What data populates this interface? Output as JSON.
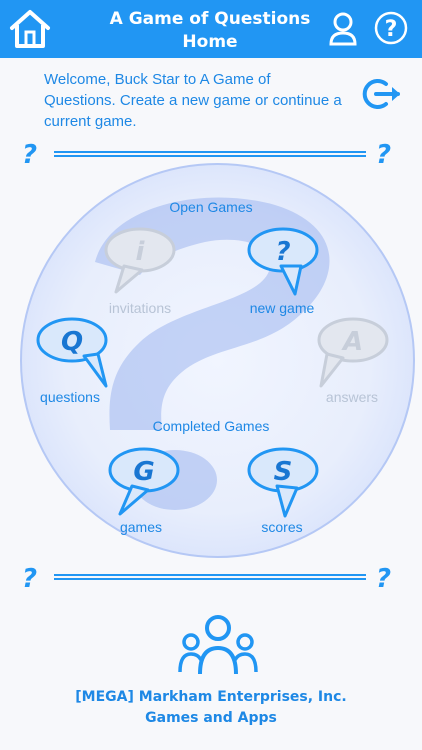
{
  "header": {
    "title_line1": "A Game of Questions",
    "title_line2": "Home",
    "home_icon": "home-icon",
    "profile_icon": "user-icon",
    "help_icon": "help-icon"
  },
  "welcome": {
    "text": "Welcome, Buck Star to A Game of Questions. Create a new game or continue a current game."
  },
  "logout_icon": "logout-icon",
  "divider_mark": "?",
  "open_games": {
    "heading": "Open Games",
    "items": [
      {
        "label": "invitations",
        "glyph": "i",
        "active": false
      },
      {
        "label": "new game",
        "glyph": "?",
        "active": true
      },
      {
        "label": "questions",
        "glyph": "Q",
        "active": true
      },
      {
        "label": "answers",
        "glyph": "A",
        "active": false
      }
    ]
  },
  "completed_games": {
    "heading": "Completed Games",
    "items": [
      {
        "label": "games",
        "glyph": "G",
        "active": true
      },
      {
        "label": "scores",
        "glyph": "S",
        "active": true
      }
    ]
  },
  "footer": {
    "line1": "[MEGA] Markham Enterprises, Inc.",
    "line2": "Games and Apps",
    "icon": "team-icon"
  },
  "colors": {
    "primary": "#2196f3",
    "text": "#1e88e5",
    "inactive": "#b8c4d6",
    "circle": "#d6e1fb"
  }
}
